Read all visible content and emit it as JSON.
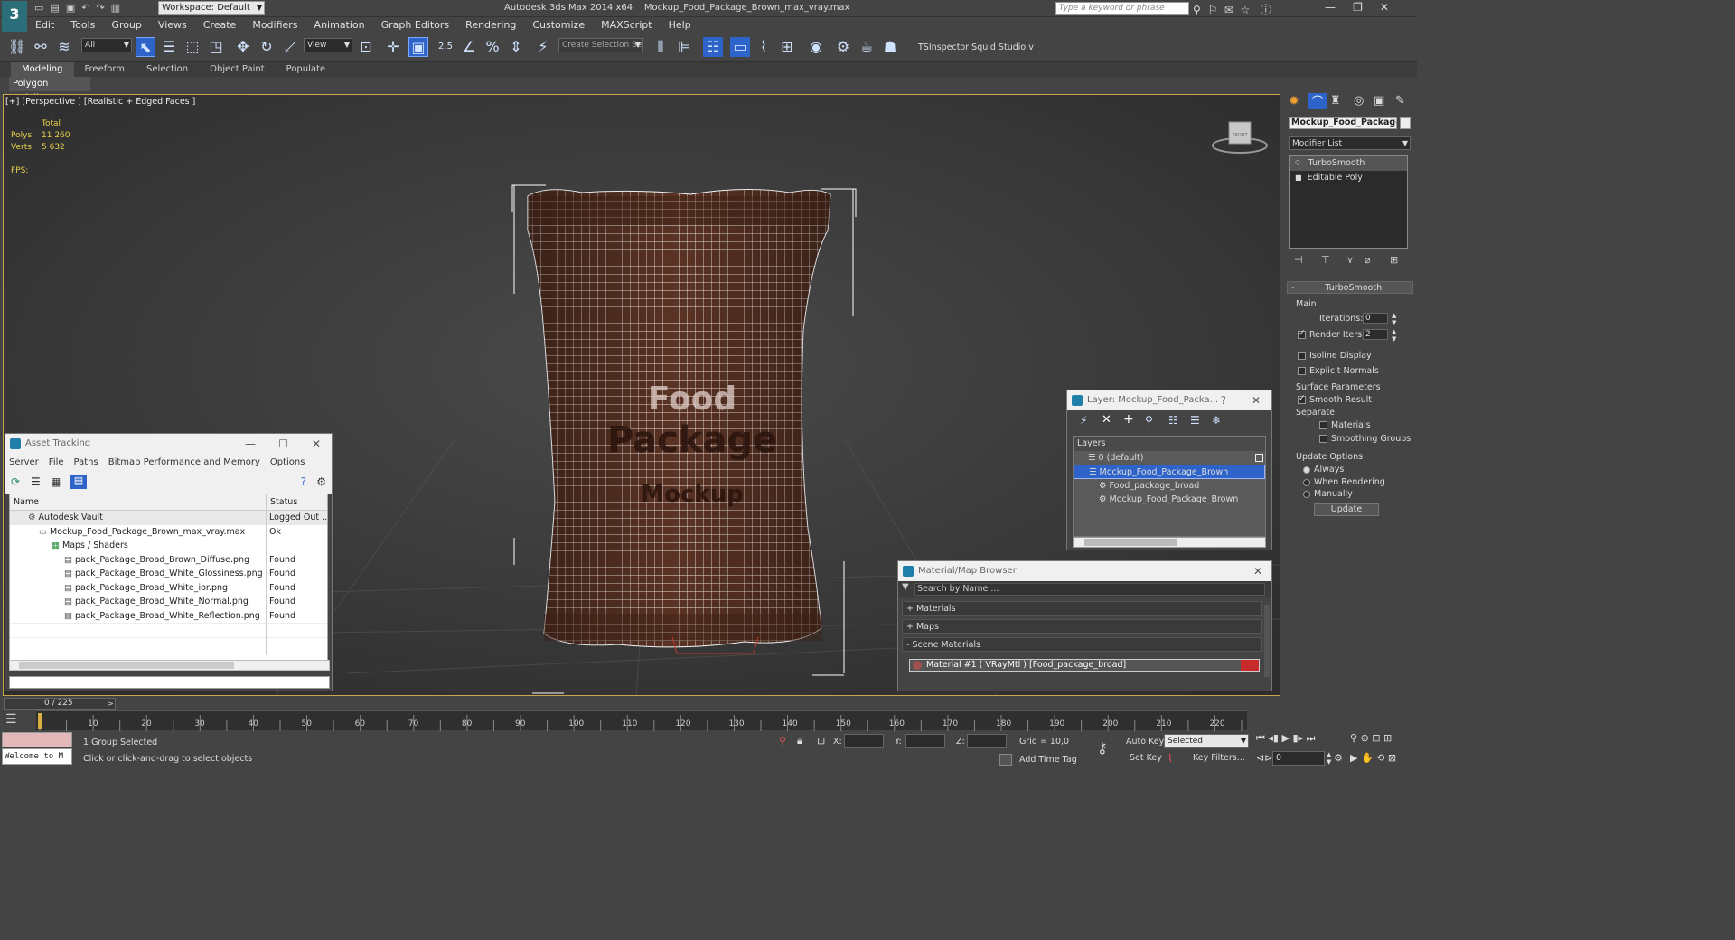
{
  "app": {
    "title": "Autodesk 3ds Max  2014 x64",
    "file": "Mockup_Food_Package_Brown_max_vray.max",
    "workspace": "Workspace: Default",
    "search_placeholder": "Type a keyword or phrase"
  },
  "menu": [
    "Edit",
    "Tools",
    "Group",
    "Views",
    "Create",
    "Modifiers",
    "Animation",
    "Graph Editors",
    "Rendering",
    "Customize",
    "MAXScript",
    "Help"
  ],
  "toolbar": {
    "filter": "All",
    "coord": "View",
    "snap_value": "2.5",
    "selection_set": "Create Selection Se",
    "plugins": "TSInspector  Squid Studio v"
  },
  "ribbon": {
    "tabs": [
      "Modeling",
      "Freeform",
      "Selection",
      "Object Paint",
      "Populate"
    ],
    "active_tab": "Modeling",
    "sub_label": "Polygon Modeling"
  },
  "viewport": {
    "label": "[+] [Perspective ] [Realistic + Edged Faces ]",
    "stats_header": "Total",
    "polys_label": "Polys:",
    "polys_value": "11 260",
    "verts_label": "Verts:",
    "verts_value": "5 632",
    "fps_label": "FPS:",
    "viewcube_label": "FRONT",
    "package_text_1": "Food",
    "package_text_2": "Package",
    "package_text_3": "Mockup"
  },
  "asset_tracking": {
    "title": "Asset Tracking",
    "menu": [
      "Server",
      "File",
      "Paths",
      "Bitmap Performance and Memory",
      "Options"
    ],
    "col_name": "Name",
    "col_status": "Status",
    "rows": [
      {
        "name": "Autodesk Vault",
        "status": "Logged Out ..."
      },
      {
        "name": "Mockup_Food_Package_Brown_max_vray.max",
        "status": "Ok"
      },
      {
        "name": "Maps / Shaders",
        "status": ""
      },
      {
        "name": "pack_Package_Broad_Brown_Diffuse.png",
        "status": "Found"
      },
      {
        "name": "pack_Package_Broad_White_Glossiness.png",
        "status": "Found"
      },
      {
        "name": "pack_Package_Broad_White_ior.png",
        "status": "Found"
      },
      {
        "name": "pack_Package_Broad_White_Normal.png",
        "status": "Found"
      },
      {
        "name": "pack_Package_Broad_White_Reflection.png",
        "status": "Found"
      }
    ]
  },
  "layer_panel": {
    "title": "Layer: Mockup_Food_Packa...",
    "help": "?",
    "header": "Layers",
    "items": [
      "0 (default)",
      "Mockup_Food_Package_Brown",
      "Food_package_broad",
      "Mockup_Food_Package_Brown"
    ]
  },
  "material_browser": {
    "title": "Material/Map Browser",
    "search_placeholder": "Search by Name ...",
    "groups": [
      "+ Materials",
      "+ Maps",
      "- Scene Materials"
    ],
    "material": "Material #1  ( VRayMtl )  [Food_package_broad]"
  },
  "command_panel": {
    "object_name": "Mockup_Food_Package_",
    "modifier_list": "Modifier List",
    "stack": [
      "TurboSmooth",
      "Editable Poly"
    ],
    "rollout_title": "TurboSmooth",
    "main_label": "Main",
    "iterations_label": "Iterations:",
    "iterations_value": "0",
    "render_iters_label": "Render Iters:",
    "render_iters_value": "2",
    "isoline": "Isoline Display",
    "explicit_normals": "Explicit Normals",
    "surface_params": "Surface Parameters",
    "smooth_result": "Smooth Result",
    "separate": "Separate",
    "materials": "Materials",
    "smoothing_groups": "Smoothing Groups",
    "update_options": "Update Options",
    "always": "Always",
    "when_rendering": "When Rendering",
    "manually": "Manually",
    "update_button": "Update"
  },
  "timeline": {
    "frame_counter": "0 / 225",
    "ticks": [
      "10",
      "20",
      "30",
      "40",
      "50",
      "60",
      "70",
      "80",
      "90",
      "100",
      "110",
      "120",
      "130",
      "140",
      "150",
      "160",
      "170",
      "180",
      "190",
      "200",
      "210",
      "220"
    ]
  },
  "status": {
    "script_listener": "Welcome to M",
    "selection": "1 Group Selected",
    "prompt": "Click or click-and-drag to select objects",
    "x_label": "X:",
    "y_label": "Y:",
    "z_label": "Z:",
    "grid": "Grid = 10,0",
    "add_time_tag": "Add Time Tag",
    "auto_key": "Auto Key",
    "key_mode": "Selected",
    "set_key": "Set Key",
    "key_filters": "Key Filters...",
    "current_frame": "0"
  },
  "colors": {
    "package": "#5a3324",
    "selection_blue": "#2e63c9",
    "viewport_border": "#c8a84b",
    "stats_yellow": "#e8d24a"
  }
}
